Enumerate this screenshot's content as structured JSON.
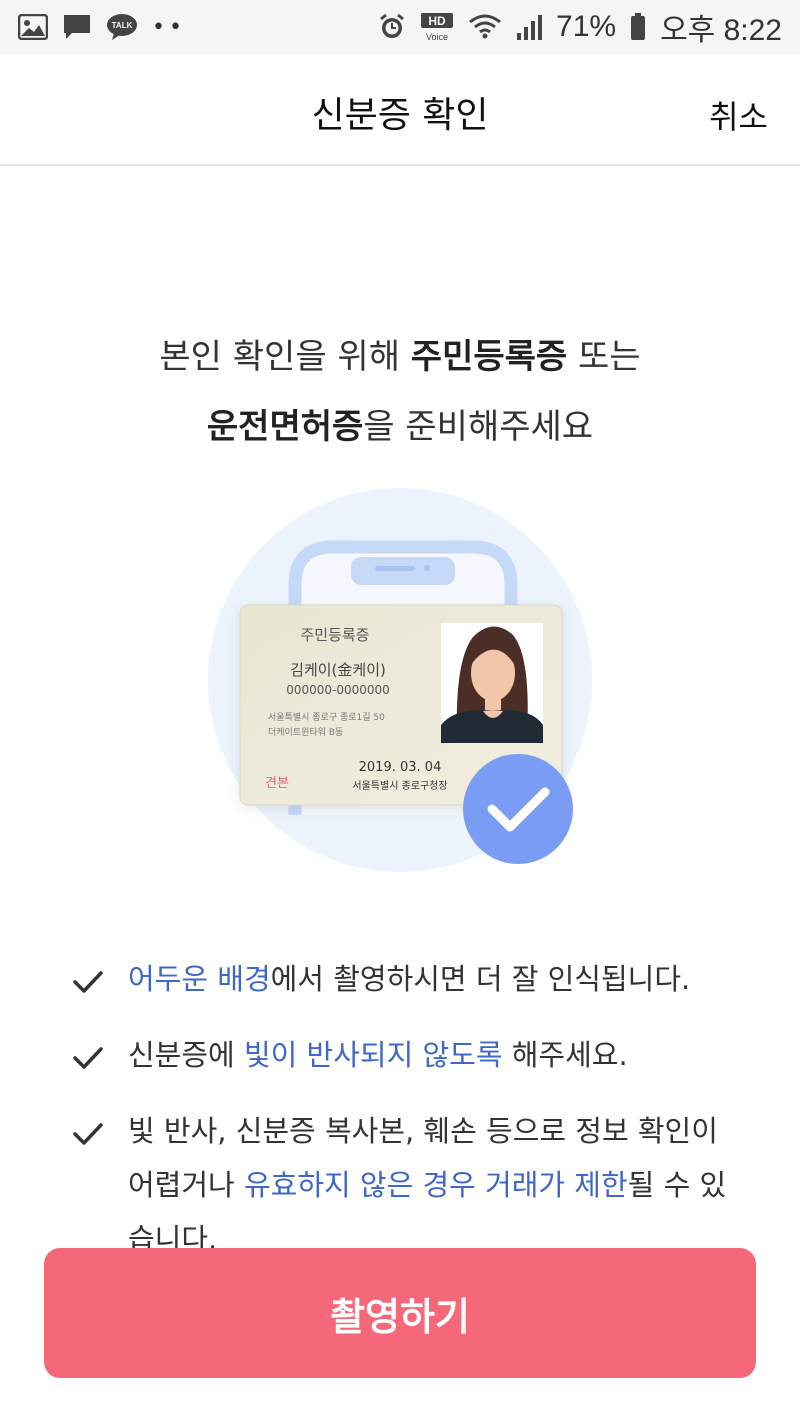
{
  "status_bar": {
    "battery": "71%",
    "time": "오후 8:22",
    "hd_voice_label": "HD",
    "voice_label": "Voice",
    "talk_label": "TALK",
    "icons": [
      "gallery-icon",
      "message-icon",
      "kakaotalk-icon",
      "more-dots-icon",
      "alarm-icon",
      "hd-voice-icon",
      "wifi-icon",
      "signal-icon",
      "battery-icon"
    ]
  },
  "header": {
    "title": "신분증 확인",
    "cancel_label": "취소"
  },
  "headline": {
    "line1_pre": "본인 확인을 위해 ",
    "line1_bold": "주민등록증",
    "line1_post": " 또는",
    "line2_bold": "운전면허증",
    "line2_post": "을 준비해주세요"
  },
  "id_card": {
    "title": "주민등록증",
    "name": "김케이(金케이)",
    "number": "000000-0000000",
    "address_line1": "서울특별시 종로구 종로1길 50",
    "address_line2": "더케이트윈타워 B동",
    "date": "2019. 03. 04",
    "issuer": "서울특별시 종로구청장",
    "sample_label": "견본"
  },
  "tips": [
    {
      "parts": [
        {
          "text": "어두운 배경",
          "hl": true
        },
        {
          "text": "에서 촬영하시면 더 잘 인식됩니다.",
          "hl": false
        }
      ]
    },
    {
      "parts": [
        {
          "text": "신분증에 ",
          "hl": false
        },
        {
          "text": "빛이 반사되지 않도록",
          "hl": true
        },
        {
          "text": " 해주세요.",
          "hl": false
        }
      ]
    },
    {
      "parts": [
        {
          "text": "빛 반사, 신분증 복사본, 훼손 등으로 정보 확인이 어렵거나 ",
          "hl": false
        },
        {
          "text": "유효하지 않은 경우 거래가 제한",
          "hl": true
        },
        {
          "text": "될 수 있습니다.",
          "hl": false
        }
      ]
    }
  ],
  "button": {
    "shoot_label": "촬영하기"
  },
  "colors": {
    "accent": "#f4687a",
    "highlight": "#3f67c8",
    "check_badge": "#7b9cf5"
  }
}
